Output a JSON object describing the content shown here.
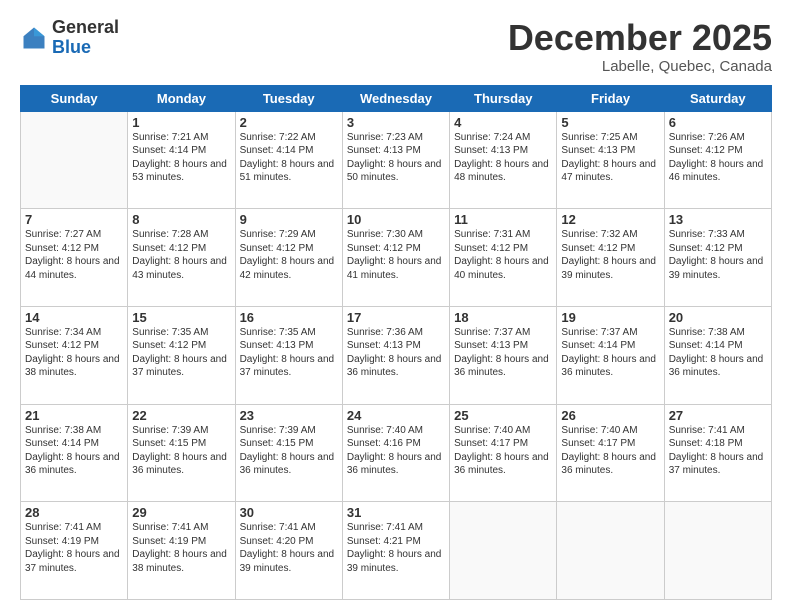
{
  "header": {
    "logo_general": "General",
    "logo_blue": "Blue",
    "month": "December 2025",
    "location": "Labelle, Quebec, Canada"
  },
  "weekdays": [
    "Sunday",
    "Monday",
    "Tuesday",
    "Wednesday",
    "Thursday",
    "Friday",
    "Saturday"
  ],
  "weeks": [
    [
      {
        "day": "",
        "sunrise": "",
        "sunset": "",
        "daylight": ""
      },
      {
        "day": "1",
        "sunrise": "Sunrise: 7:21 AM",
        "sunset": "Sunset: 4:14 PM",
        "daylight": "Daylight: 8 hours and 53 minutes."
      },
      {
        "day": "2",
        "sunrise": "Sunrise: 7:22 AM",
        "sunset": "Sunset: 4:14 PM",
        "daylight": "Daylight: 8 hours and 51 minutes."
      },
      {
        "day": "3",
        "sunrise": "Sunrise: 7:23 AM",
        "sunset": "Sunset: 4:13 PM",
        "daylight": "Daylight: 8 hours and 50 minutes."
      },
      {
        "day": "4",
        "sunrise": "Sunrise: 7:24 AM",
        "sunset": "Sunset: 4:13 PM",
        "daylight": "Daylight: 8 hours and 48 minutes."
      },
      {
        "day": "5",
        "sunrise": "Sunrise: 7:25 AM",
        "sunset": "Sunset: 4:13 PM",
        "daylight": "Daylight: 8 hours and 47 minutes."
      },
      {
        "day": "6",
        "sunrise": "Sunrise: 7:26 AM",
        "sunset": "Sunset: 4:12 PM",
        "daylight": "Daylight: 8 hours and 46 minutes."
      }
    ],
    [
      {
        "day": "7",
        "sunrise": "Sunrise: 7:27 AM",
        "sunset": "Sunset: 4:12 PM",
        "daylight": "Daylight: 8 hours and 44 minutes."
      },
      {
        "day": "8",
        "sunrise": "Sunrise: 7:28 AM",
        "sunset": "Sunset: 4:12 PM",
        "daylight": "Daylight: 8 hours and 43 minutes."
      },
      {
        "day": "9",
        "sunrise": "Sunrise: 7:29 AM",
        "sunset": "Sunset: 4:12 PM",
        "daylight": "Daylight: 8 hours and 42 minutes."
      },
      {
        "day": "10",
        "sunrise": "Sunrise: 7:30 AM",
        "sunset": "Sunset: 4:12 PM",
        "daylight": "Daylight: 8 hours and 41 minutes."
      },
      {
        "day": "11",
        "sunrise": "Sunrise: 7:31 AM",
        "sunset": "Sunset: 4:12 PM",
        "daylight": "Daylight: 8 hours and 40 minutes."
      },
      {
        "day": "12",
        "sunrise": "Sunrise: 7:32 AM",
        "sunset": "Sunset: 4:12 PM",
        "daylight": "Daylight: 8 hours and 39 minutes."
      },
      {
        "day": "13",
        "sunrise": "Sunrise: 7:33 AM",
        "sunset": "Sunset: 4:12 PM",
        "daylight": "Daylight: 8 hours and 39 minutes."
      }
    ],
    [
      {
        "day": "14",
        "sunrise": "Sunrise: 7:34 AM",
        "sunset": "Sunset: 4:12 PM",
        "daylight": "Daylight: 8 hours and 38 minutes."
      },
      {
        "day": "15",
        "sunrise": "Sunrise: 7:35 AM",
        "sunset": "Sunset: 4:12 PM",
        "daylight": "Daylight: 8 hours and 37 minutes."
      },
      {
        "day": "16",
        "sunrise": "Sunrise: 7:35 AM",
        "sunset": "Sunset: 4:13 PM",
        "daylight": "Daylight: 8 hours and 37 minutes."
      },
      {
        "day": "17",
        "sunrise": "Sunrise: 7:36 AM",
        "sunset": "Sunset: 4:13 PM",
        "daylight": "Daylight: 8 hours and 36 minutes."
      },
      {
        "day": "18",
        "sunrise": "Sunrise: 7:37 AM",
        "sunset": "Sunset: 4:13 PM",
        "daylight": "Daylight: 8 hours and 36 minutes."
      },
      {
        "day": "19",
        "sunrise": "Sunrise: 7:37 AM",
        "sunset": "Sunset: 4:14 PM",
        "daylight": "Daylight: 8 hours and 36 minutes."
      },
      {
        "day": "20",
        "sunrise": "Sunrise: 7:38 AM",
        "sunset": "Sunset: 4:14 PM",
        "daylight": "Daylight: 8 hours and 36 minutes."
      }
    ],
    [
      {
        "day": "21",
        "sunrise": "Sunrise: 7:38 AM",
        "sunset": "Sunset: 4:14 PM",
        "daylight": "Daylight: 8 hours and 36 minutes."
      },
      {
        "day": "22",
        "sunrise": "Sunrise: 7:39 AM",
        "sunset": "Sunset: 4:15 PM",
        "daylight": "Daylight: 8 hours and 36 minutes."
      },
      {
        "day": "23",
        "sunrise": "Sunrise: 7:39 AM",
        "sunset": "Sunset: 4:15 PM",
        "daylight": "Daylight: 8 hours and 36 minutes."
      },
      {
        "day": "24",
        "sunrise": "Sunrise: 7:40 AM",
        "sunset": "Sunset: 4:16 PM",
        "daylight": "Daylight: 8 hours and 36 minutes."
      },
      {
        "day": "25",
        "sunrise": "Sunrise: 7:40 AM",
        "sunset": "Sunset: 4:17 PM",
        "daylight": "Daylight: 8 hours and 36 minutes."
      },
      {
        "day": "26",
        "sunrise": "Sunrise: 7:40 AM",
        "sunset": "Sunset: 4:17 PM",
        "daylight": "Daylight: 8 hours and 36 minutes."
      },
      {
        "day": "27",
        "sunrise": "Sunrise: 7:41 AM",
        "sunset": "Sunset: 4:18 PM",
        "daylight": "Daylight: 8 hours and 37 minutes."
      }
    ],
    [
      {
        "day": "28",
        "sunrise": "Sunrise: 7:41 AM",
        "sunset": "Sunset: 4:19 PM",
        "daylight": "Daylight: 8 hours and 37 minutes."
      },
      {
        "day": "29",
        "sunrise": "Sunrise: 7:41 AM",
        "sunset": "Sunset: 4:19 PM",
        "daylight": "Daylight: 8 hours and 38 minutes."
      },
      {
        "day": "30",
        "sunrise": "Sunrise: 7:41 AM",
        "sunset": "Sunset: 4:20 PM",
        "daylight": "Daylight: 8 hours and 39 minutes."
      },
      {
        "day": "31",
        "sunrise": "Sunrise: 7:41 AM",
        "sunset": "Sunset: 4:21 PM",
        "daylight": "Daylight: 8 hours and 39 minutes."
      },
      {
        "day": "",
        "sunrise": "",
        "sunset": "",
        "daylight": ""
      },
      {
        "day": "",
        "sunrise": "",
        "sunset": "",
        "daylight": ""
      },
      {
        "day": "",
        "sunrise": "",
        "sunset": "",
        "daylight": ""
      }
    ]
  ]
}
